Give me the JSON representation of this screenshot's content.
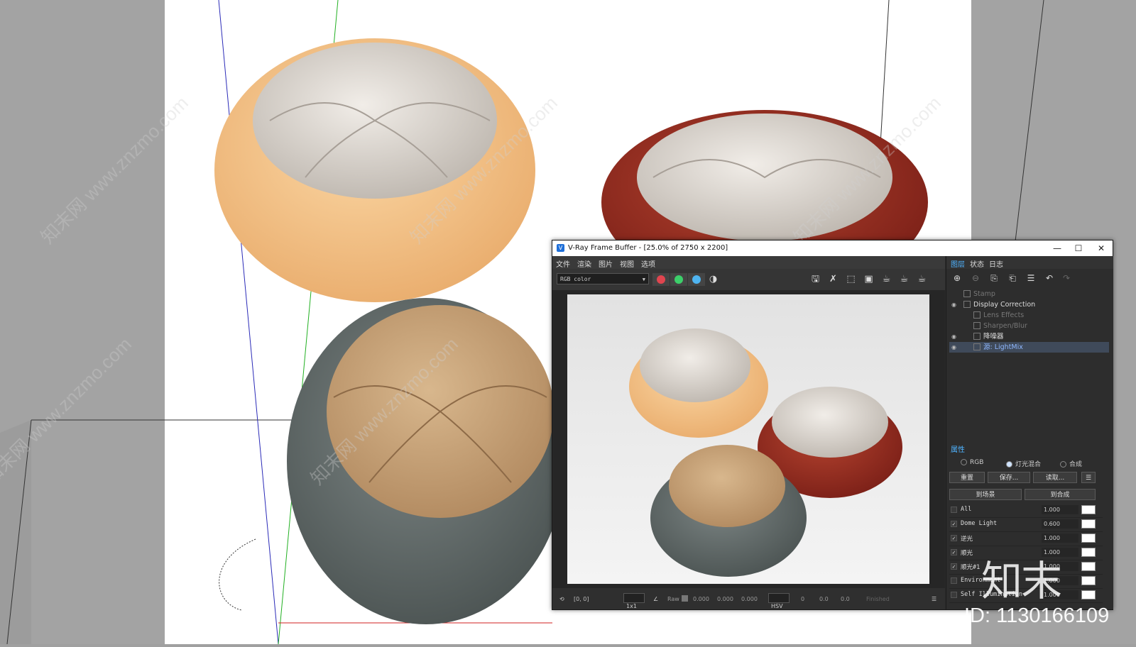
{
  "window": {
    "title": "V-Ray Frame Buffer - [25.0% of 2750 x 2200]",
    "minimize": "—",
    "maximize": "☐",
    "close": "✕"
  },
  "menu": [
    "文件",
    "渲染",
    "图片",
    "视图",
    "选项"
  ],
  "toolbar": {
    "channel": "RGB color",
    "colors": {
      "red": "#e0454f",
      "green": "#3ccf6a",
      "blue": "#4fb4f0"
    }
  },
  "status": {
    "coords": "[0, 0]",
    "zoom": "1x1",
    "raw_label": "Raw",
    "raw_values": [
      "0.000",
      "0.000",
      "0.000"
    ],
    "color_mode": "HSV",
    "hsv_values": [
      "0",
      "0.0",
      "0.0"
    ],
    "state": "Finished"
  },
  "panel": {
    "tabs": [
      "图层",
      "状态",
      "日志"
    ],
    "layers": [
      {
        "label": "Stamp"
      },
      {
        "label": "Display Correction"
      },
      {
        "label": "Lens Effects"
      },
      {
        "label": "Sharpen/Blur"
      },
      {
        "label": "降噪器"
      },
      {
        "label": "源: LightMix"
      }
    ],
    "props_title": "属性",
    "modes": [
      "RGB",
      "灯光混合",
      "合成"
    ],
    "buttons": {
      "reset": "重置",
      "save": "保存...",
      "load": "读取...",
      "to_scene": "到场景",
      "to_comp": "到合成"
    },
    "lights": [
      {
        "name": "All",
        "value": "1.000",
        "checked": false
      },
      {
        "name": "Dome Light",
        "value": "0.600",
        "checked": true
      },
      {
        "name": "逆光",
        "value": "1.000",
        "checked": true
      },
      {
        "name": "顺光",
        "value": "1.000",
        "checked": true
      },
      {
        "name": "顺光#1",
        "value": "1.000",
        "checked": true
      },
      {
        "name": "Environment",
        "value": "1.000",
        "checked": false
      },
      {
        "name": "Self Illumination",
        "value": "1.000",
        "checked": false
      }
    ]
  },
  "watermark": {
    "logo": "知末",
    "id": "ID: 1130166109",
    "tile": "知末网 www.znzmo.com"
  }
}
